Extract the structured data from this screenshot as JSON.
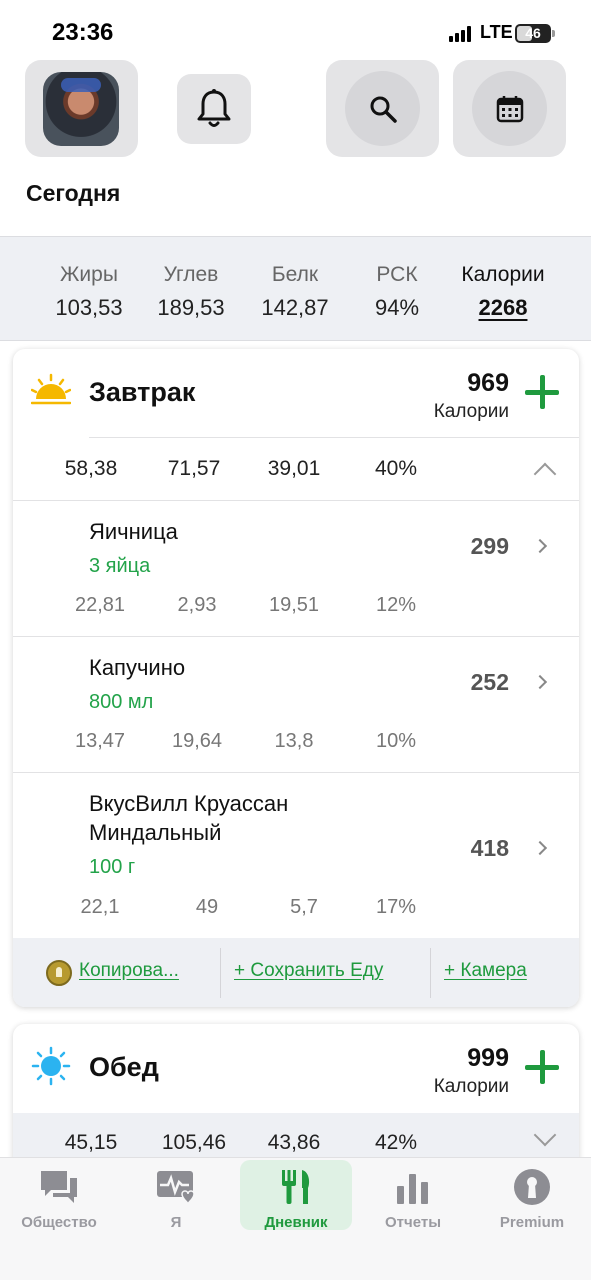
{
  "status_bar": {
    "time": "23:36",
    "network": "LTE",
    "battery": "46"
  },
  "header": {
    "title": "Сегодня"
  },
  "totals": [
    {
      "label": "Жиры",
      "value": "103,53"
    },
    {
      "label": "Углев",
      "value": "189,53"
    },
    {
      "label": "Белк",
      "value": "142,87"
    },
    {
      "label": "РСК",
      "value": "94%"
    },
    {
      "label": "Калории",
      "value": "2268"
    }
  ],
  "breakfast": {
    "name": "Завтрак",
    "calories": "969",
    "calories_label": "Калории",
    "summary": [
      "58,38",
      "71,57",
      "39,01",
      "40%"
    ],
    "items": [
      {
        "name": "Яичница",
        "portion": "3 яйца",
        "calories": "299",
        "macros": [
          "22,81",
          "2,93",
          "19,51",
          "12%"
        ]
      },
      {
        "name": "Капучино",
        "portion": "800 мл",
        "calories": "252",
        "macros": [
          "13,47",
          "19,64",
          "13,8",
          "10%"
        ]
      },
      {
        "name_line1": "ВкусВилл Круассан",
        "name_line2": "Миндальный",
        "portion": "100 г",
        "calories": "418",
        "macros": [
          "22,1",
          "49",
          "5,7",
          "17%"
        ]
      }
    ],
    "actions": {
      "copy": "Копирова...",
      "save": "+ Сохранить Еду",
      "camera": "+ Камера"
    }
  },
  "lunch": {
    "name": "Обед",
    "calories": "999",
    "calories_label": "Калории",
    "summary": [
      "45,15",
      "105,46",
      "43,86",
      "42%"
    ]
  },
  "tabs": [
    {
      "label": "Общество",
      "icon": "chat-bubbles-icon"
    },
    {
      "label": "Я",
      "icon": "heart-monitor-icon"
    },
    {
      "label": "Дневник",
      "icon": "fork-knife-icon",
      "active": true
    },
    {
      "label": "Отчеты",
      "icon": "bar-chart-icon"
    },
    {
      "label": "Premium",
      "icon": "premium-keyhole-icon"
    }
  ],
  "colors": {
    "accent": "#1f9a3e",
    "portion": "#23a34a",
    "tile": "#e4e4e6"
  }
}
